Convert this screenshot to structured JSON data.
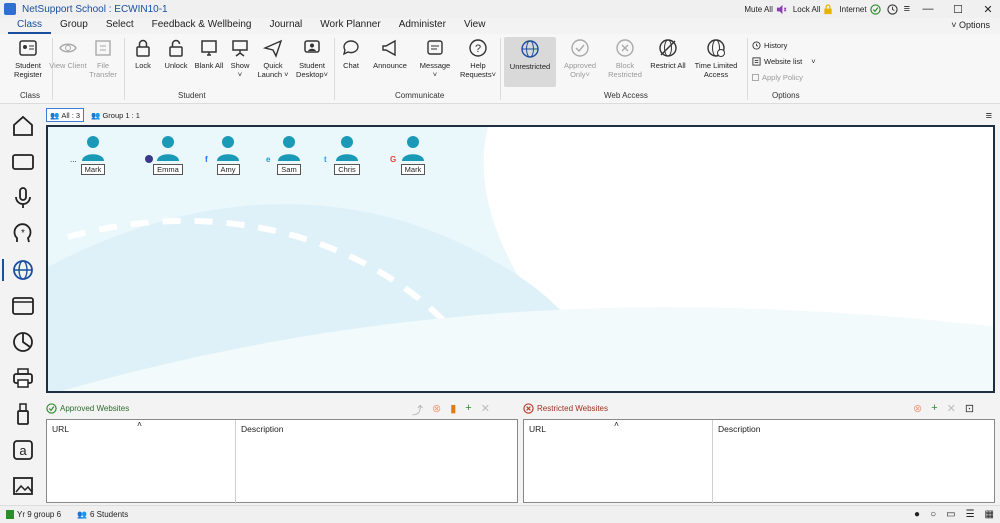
{
  "titlebar": {
    "title": "NetSupport School : ECWIN10-1",
    "mute_all": "Mute All",
    "lock_all": "Lock All",
    "internet": "Internet"
  },
  "menu": {
    "items": [
      "Class",
      "Group",
      "Select",
      "Feedback & Wellbeing",
      "Journal",
      "Work Planner",
      "Administer",
      "View"
    ],
    "options": "Options"
  },
  "ribbon": {
    "class_group": {
      "label": "Class",
      "student_register": "Student Register"
    },
    "student_group": {
      "label": "Student",
      "view_client": "View Client",
      "file_transfer": "File Transfer",
      "lock": "Lock",
      "unlock": "Unlock",
      "blank_all": "Blank All",
      "show": "Show",
      "quick_launch": "Quick Launch",
      "student_desktop": "Student Desktop"
    },
    "communicate_group": {
      "label": "Communicate",
      "chat": "Chat",
      "announce": "Announce",
      "message": "Message",
      "help_requests": "Help Requests"
    },
    "web_group": {
      "label": "Web Access",
      "unrestricted": "Unrestricted",
      "approved_only": "Approved Only",
      "block_restricted": "Block Restricted",
      "restrict_all": "Restrict All",
      "time_limited": "Time Limited Access"
    },
    "options_group": {
      "label": "Options",
      "history": "History",
      "website_list": "Website list",
      "apply_policy": "Apply Policy"
    }
  },
  "tabs": {
    "all": "All : 3",
    "group1": "Group 1 : 1"
  },
  "students": [
    {
      "name": "Mark",
      "badge": "..."
    },
    {
      "name": "Emma",
      "badge": ""
    },
    {
      "name": "Amy",
      "badge": "f"
    },
    {
      "name": "Sam",
      "badge": "e"
    },
    {
      "name": "Chris",
      "badge": "t"
    },
    {
      "name": "Mark",
      "badge": "G"
    }
  ],
  "approved_panel": {
    "title": "Approved Websites",
    "col_url": "URL",
    "col_desc": "Description"
  },
  "restricted_panel": {
    "title": "Restricted Websites",
    "col_url": "URL",
    "col_desc": "Description"
  },
  "statusbar": {
    "group": "Yr 9 group 6",
    "students": "6 Students"
  },
  "colors": {
    "accent": "#1a4fa0",
    "avatar": "#1b9ab7",
    "approved": "#2e8b2e",
    "restricted": "#c0392b"
  }
}
